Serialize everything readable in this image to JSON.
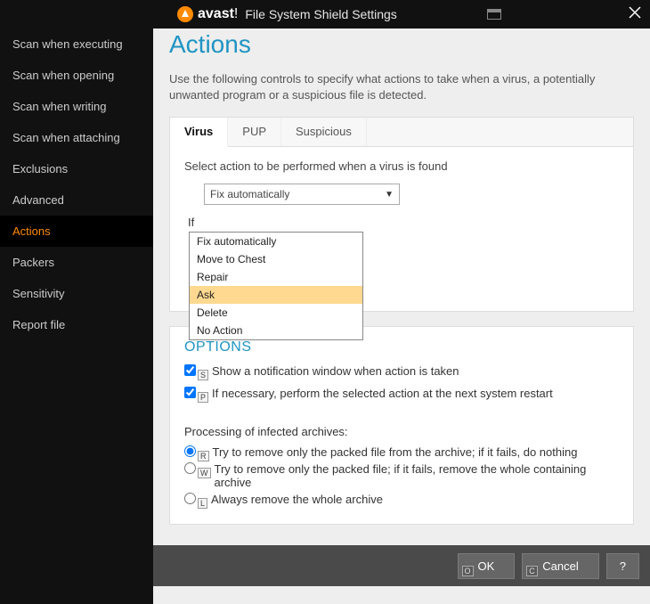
{
  "titlebar": {
    "brand": "avast",
    "bang": "!",
    "title": "File System Shield Settings"
  },
  "sidebar": {
    "items": [
      {
        "label": "Scan when executing"
      },
      {
        "label": "Scan when opening"
      },
      {
        "label": "Scan when writing"
      },
      {
        "label": "Scan when attaching"
      },
      {
        "label": "Exclusions"
      },
      {
        "label": "Advanced"
      },
      {
        "label": "Actions"
      },
      {
        "label": "Packers"
      },
      {
        "label": "Sensitivity"
      },
      {
        "label": "Report file"
      }
    ],
    "active_index": 6
  },
  "page": {
    "title": "Actions",
    "description": "Use the following controls to specify what actions to take when a virus, a potentially unwanted program or a suspicious file is detected.",
    "tabs": {
      "virus": "Virus",
      "pup": "PUP",
      "suspicious": "Suspicious"
    },
    "tab_instruction": "Select action to be performed when a virus is found",
    "select": {
      "value": "Fix automatically"
    },
    "dropdown_options": [
      "Fix automatically",
      "Move to Chest",
      "Repair",
      "Ask",
      "Delete",
      "No Action"
    ],
    "dropdown_highlight_index": 3,
    "if_label": "If",
    "options_title": "OPTIONS",
    "chk_notify": "Show a notification window when action is taken",
    "chk_notify_mn": "S",
    "chk_restart": "If necessary, perform the selected action at the next system restart",
    "chk_restart_mn": "P",
    "archives_head": "Processing of infected archives:",
    "radio1": "Try to remove only the packed file from the archive; if it fails, do nothing",
    "radio1_mn": "R",
    "radio2": "Try to remove only the packed file; if it fails, remove the whole containing archive",
    "radio2_mn": "W",
    "radio3": "Always remove the whole archive",
    "radio3_mn": "L"
  },
  "footer": {
    "ok": "OK",
    "ok_mn": "O",
    "cancel": "Cancel",
    "cancel_mn": "C",
    "help": "?"
  }
}
